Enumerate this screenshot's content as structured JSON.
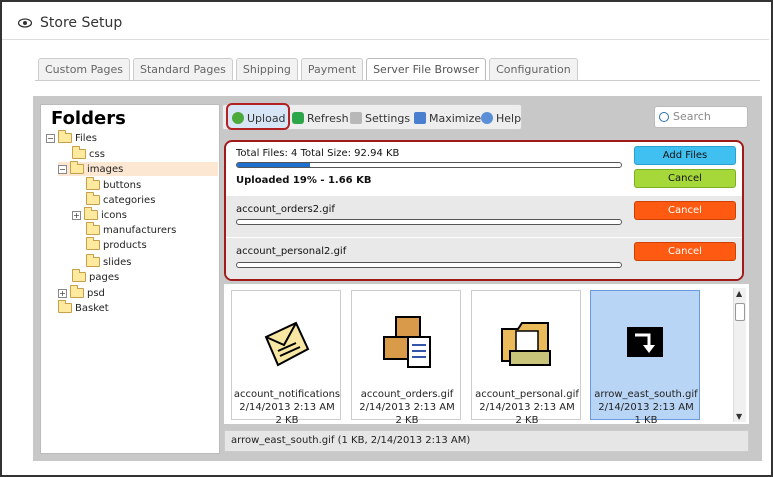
{
  "header": {
    "title": "Store Setup"
  },
  "tabs": [
    "Custom Pages",
    "Standard Pages",
    "Shipping",
    "Payment",
    "Server File Browser",
    "Configuration"
  ],
  "folders": {
    "title": "Folders",
    "items": [
      "Files",
      "css",
      "images",
      "buttons",
      "categories",
      "icons",
      "manufacturers",
      "products",
      "slides",
      "pages",
      "psd",
      "Basket"
    ]
  },
  "toolbar": {
    "upload": "Upload",
    "refresh": "Refresh",
    "settings": "Settings",
    "maximize": "Maximize",
    "help": "Help",
    "search_placeholder": "Search"
  },
  "upload": {
    "summary": "Total Files: 4 Total Size: 92.94 KB",
    "progress_text": "Uploaded 19% - 1.66 KB",
    "progress": 0.19,
    "add_files": "Add Files",
    "cancel": "Cancel",
    "files": [
      "account_orders2.gif",
      "account_personal2.gif"
    ]
  },
  "files": [
    {
      "name": "account_notifications",
      "date": "2/14/2013 2:13 AM",
      "size": "2 KB"
    },
    {
      "name": "account_orders.gif",
      "date": "2/14/2013 2:13 AM",
      "size": "2 KB"
    },
    {
      "name": "account_personal.gif",
      "date": "2/14/2013 2:13 AM",
      "size": "2 KB"
    },
    {
      "name": "arrow_east_south.gif",
      "date": "2/14/2013 2:13 AM",
      "size": "1 KB"
    }
  ],
  "status": "arrow_east_south.gif (1 KB, 2/14/2013 2:13 AM)"
}
